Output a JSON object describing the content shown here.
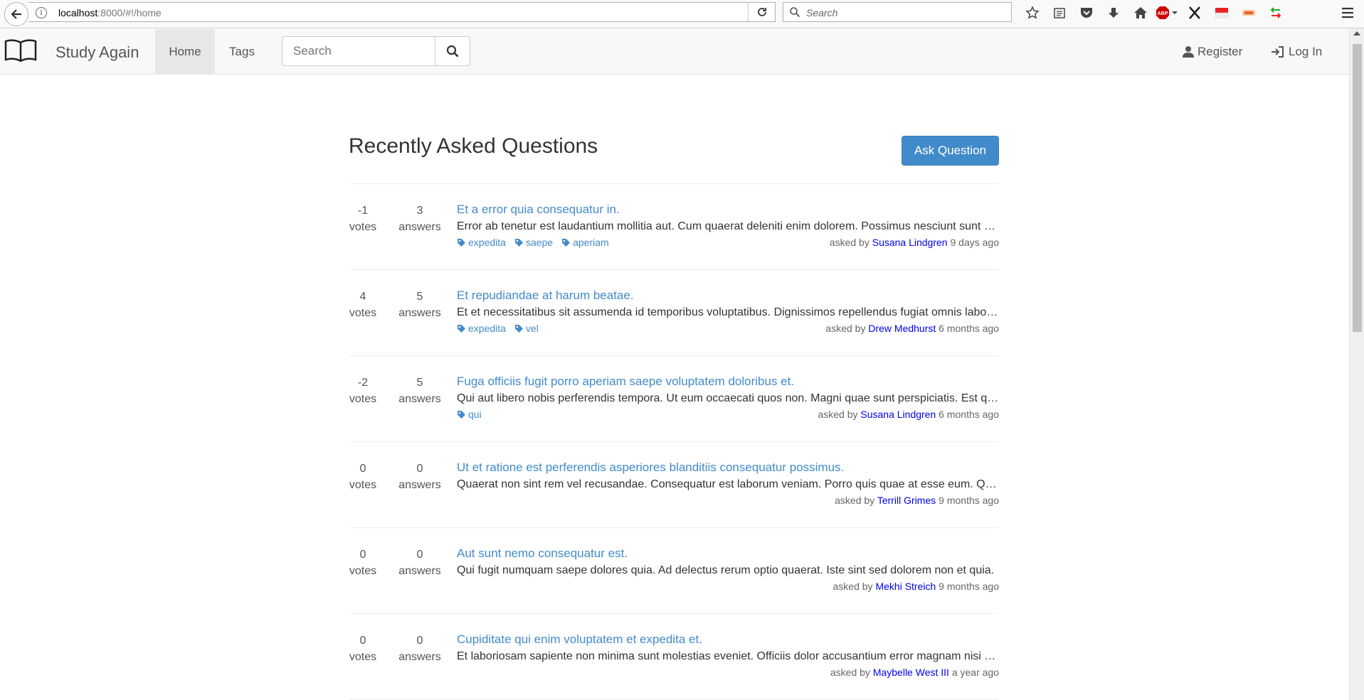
{
  "browser": {
    "url_host": "localhost",
    "url_rest": ":8000/#!/home",
    "search_placeholder": "Search",
    "abp_label": "ABP"
  },
  "navbar": {
    "brand": "Study Again",
    "home": "Home",
    "tags": "Tags",
    "search_placeholder": "Search",
    "register": "Register",
    "login": "Log In"
  },
  "page": {
    "title": "Recently Asked Questions",
    "ask_button": "Ask Question"
  },
  "questions": [
    {
      "votes": "-1",
      "votes_label": "votes",
      "answers": "3",
      "answers_label": "answers",
      "title": "Et a error quia consequatur in.",
      "excerpt": "Error ab tenetur est laudantium mollitia aut. Cum quaerat deleniti enim dolorem. Possimus nesciunt sunt voluptatem.",
      "tags": [
        "expedita",
        "saepe",
        "aperiam"
      ],
      "asked_by": "asked by ",
      "user": "Susana Lindgren",
      "time": " 9 days ago"
    },
    {
      "votes": "4",
      "votes_label": "votes",
      "answers": "5",
      "answers_label": "answers",
      "title": "Et repudiandae at harum beatae.",
      "excerpt": "Et et necessitatibus sit assumenda id temporibus voluptatibus. Dignissimos repellendus fugiat omnis laboriosam.",
      "tags": [
        "expedita",
        "vel"
      ],
      "asked_by": "asked by ",
      "user": "Drew Medhurst",
      "time": " 6 months ago"
    },
    {
      "votes": "-2",
      "votes_label": "votes",
      "answers": "5",
      "answers_label": "answers",
      "title": "Fuga officiis fugit porro aperiam saepe voluptatem doloribus et.",
      "excerpt": "Qui aut libero nobis perferendis tempora. Ut eum occaecati quos non. Magni quae sunt perspiciatis. Est qui.",
      "tags": [
        "qui"
      ],
      "asked_by": "asked by ",
      "user": "Susana Lindgren",
      "time": " 6 months ago"
    },
    {
      "votes": "0",
      "votes_label": "votes",
      "answers": "0",
      "answers_label": "answers",
      "title": "Ut et ratione est perferendis asperiores blanditiis consequatur possimus.",
      "excerpt": "Quaerat non sint rem vel recusandae. Consequatur est laborum veniam. Porro quis quae at esse eum. Quia.",
      "tags": [],
      "asked_by": "asked by ",
      "user": "Terrill Grimes",
      "time": " 9 months ago"
    },
    {
      "votes": "0",
      "votes_label": "votes",
      "answers": "0",
      "answers_label": "answers",
      "title": "Aut sunt nemo consequatur est.",
      "excerpt": "Qui fugit numquam saepe dolores quia. Ad delectus rerum optio quaerat. Iste sint sed dolorem non et quia.",
      "tags": [],
      "asked_by": "asked by ",
      "user": "Mekhi Streich",
      "time": " 9 months ago"
    },
    {
      "votes": "0",
      "votes_label": "votes",
      "answers": "0",
      "answers_label": "answers",
      "title": "Cupiditate qui enim voluptatem et expedita et.",
      "excerpt": "Et laboriosam sapiente non minima sunt molestias eveniet. Officiis dolor accusantium error magnam nisi quia.",
      "tags": [],
      "asked_by": "asked by ",
      "user": "Maybelle West III",
      "time": " a year ago"
    }
  ]
}
